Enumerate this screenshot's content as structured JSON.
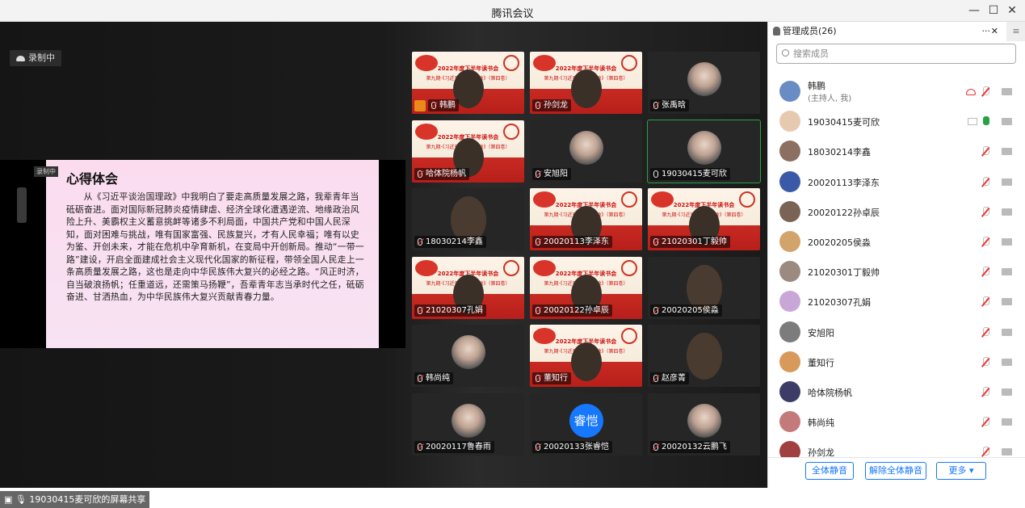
{
  "app": {
    "title": "腾讯会议"
  },
  "stage": {
    "recording_label": "录制中",
    "slide_tag": "录制中",
    "slide_title": "心得体会",
    "slide_body": "从《习近平谈治国理政》中我明白了要走高质量发展之路，我辈青年当砥砺奋进。面对国际新冠肺炎疫情肆虐、经济全球化遭遇逆流、地缘政治风险上升、美霸权主义蓄意挑衅等诸多不利局面，中国共产党和中国人民深知，面对困难与挑战，唯有国家富强、民族复兴，才有人民幸福；唯有以史为鉴、开创未来，才能在危机中孕育新机，在变局中开创新局。推动“一带一路”建设，开启全面建成社会主义现代化国家的新征程，带领全国人民走上一条高质量发展之路，这也是走向中华民族伟大复兴的必经之路。“风正时济，自当破浪扬帆；任重道远，还需策马扬鞭”，吾辈青年志当承时代之任，砥砺奋进、甘洒热血，为中华民族伟大复兴贡献青春力量。",
    "share_label": "19030415麦可欣的屏幕共享",
    "poster_line1": "2022年度下半年读书会",
    "poster_line2": "第九期·《习近平谈治国理政》（第四卷）"
  },
  "tiles": [
    {
      "name": "韩鹏",
      "type": "poster",
      "mic": "off",
      "host": true
    },
    {
      "name": "孙剑龙",
      "type": "poster",
      "mic": "off"
    },
    {
      "name": "张禹晗",
      "type": "avatar",
      "mic": "off"
    },
    {
      "name": "哈体院杨帆",
      "type": "poster",
      "mic": "off"
    },
    {
      "name": "安旭阳",
      "type": "avatar",
      "mic": "off"
    },
    {
      "name": "19030415麦可欣",
      "type": "avatar",
      "mic": "on",
      "active": true
    },
    {
      "name": "18030214李鑫",
      "type": "video",
      "mic": "off"
    },
    {
      "name": "20020113李泽东",
      "type": "poster",
      "mic": "off"
    },
    {
      "name": "21020301丁毅帅",
      "type": "poster",
      "mic": "off"
    },
    {
      "name": "21020307孔娟",
      "type": "poster",
      "mic": "off"
    },
    {
      "name": "20020122孙卓辰",
      "type": "poster",
      "mic": "off"
    },
    {
      "name": "20020205侯淼",
      "type": "video",
      "mic": "off"
    },
    {
      "name": "韩尚纯",
      "type": "avatar",
      "mic": "off"
    },
    {
      "name": "董知行",
      "type": "poster",
      "mic": "off"
    },
    {
      "name": "赵彦菁",
      "type": "video",
      "mic": "off"
    },
    {
      "name": "20020117鲁春雨",
      "type": "avatar",
      "mic": "off"
    },
    {
      "name": "20020133张睿恺",
      "type": "text-avatar",
      "avatar_text": "睿恺",
      "mic": "off"
    },
    {
      "name": "20020132云鹏飞",
      "type": "avatar",
      "mic": "off"
    }
  ],
  "panel": {
    "title": "管理成员(26)",
    "more": "···",
    "close": "✕",
    "search_placeholder": "搜索成员",
    "members": [
      {
        "name": "韩鹏",
        "sub": "(主持人, 我)",
        "icons": "host"
      },
      {
        "name": "19030415麦可欣",
        "icons": "sharer"
      },
      {
        "name": "18030214李鑫"
      },
      {
        "name": "20020113李泽东"
      },
      {
        "name": "20020122孙卓辰"
      },
      {
        "name": "20020205侯淼"
      },
      {
        "name": "21020301丁毅帅"
      },
      {
        "name": "21020307孔娟"
      },
      {
        "name": "安旭阳"
      },
      {
        "name": "董知行"
      },
      {
        "name": "哈体院杨帆"
      },
      {
        "name": "韩尚纯"
      },
      {
        "name": "孙剑龙"
      }
    ],
    "btn_mute_all": "全体静音",
    "btn_unmute_all": "解除全体静音",
    "btn_more": "更多 ▾"
  }
}
